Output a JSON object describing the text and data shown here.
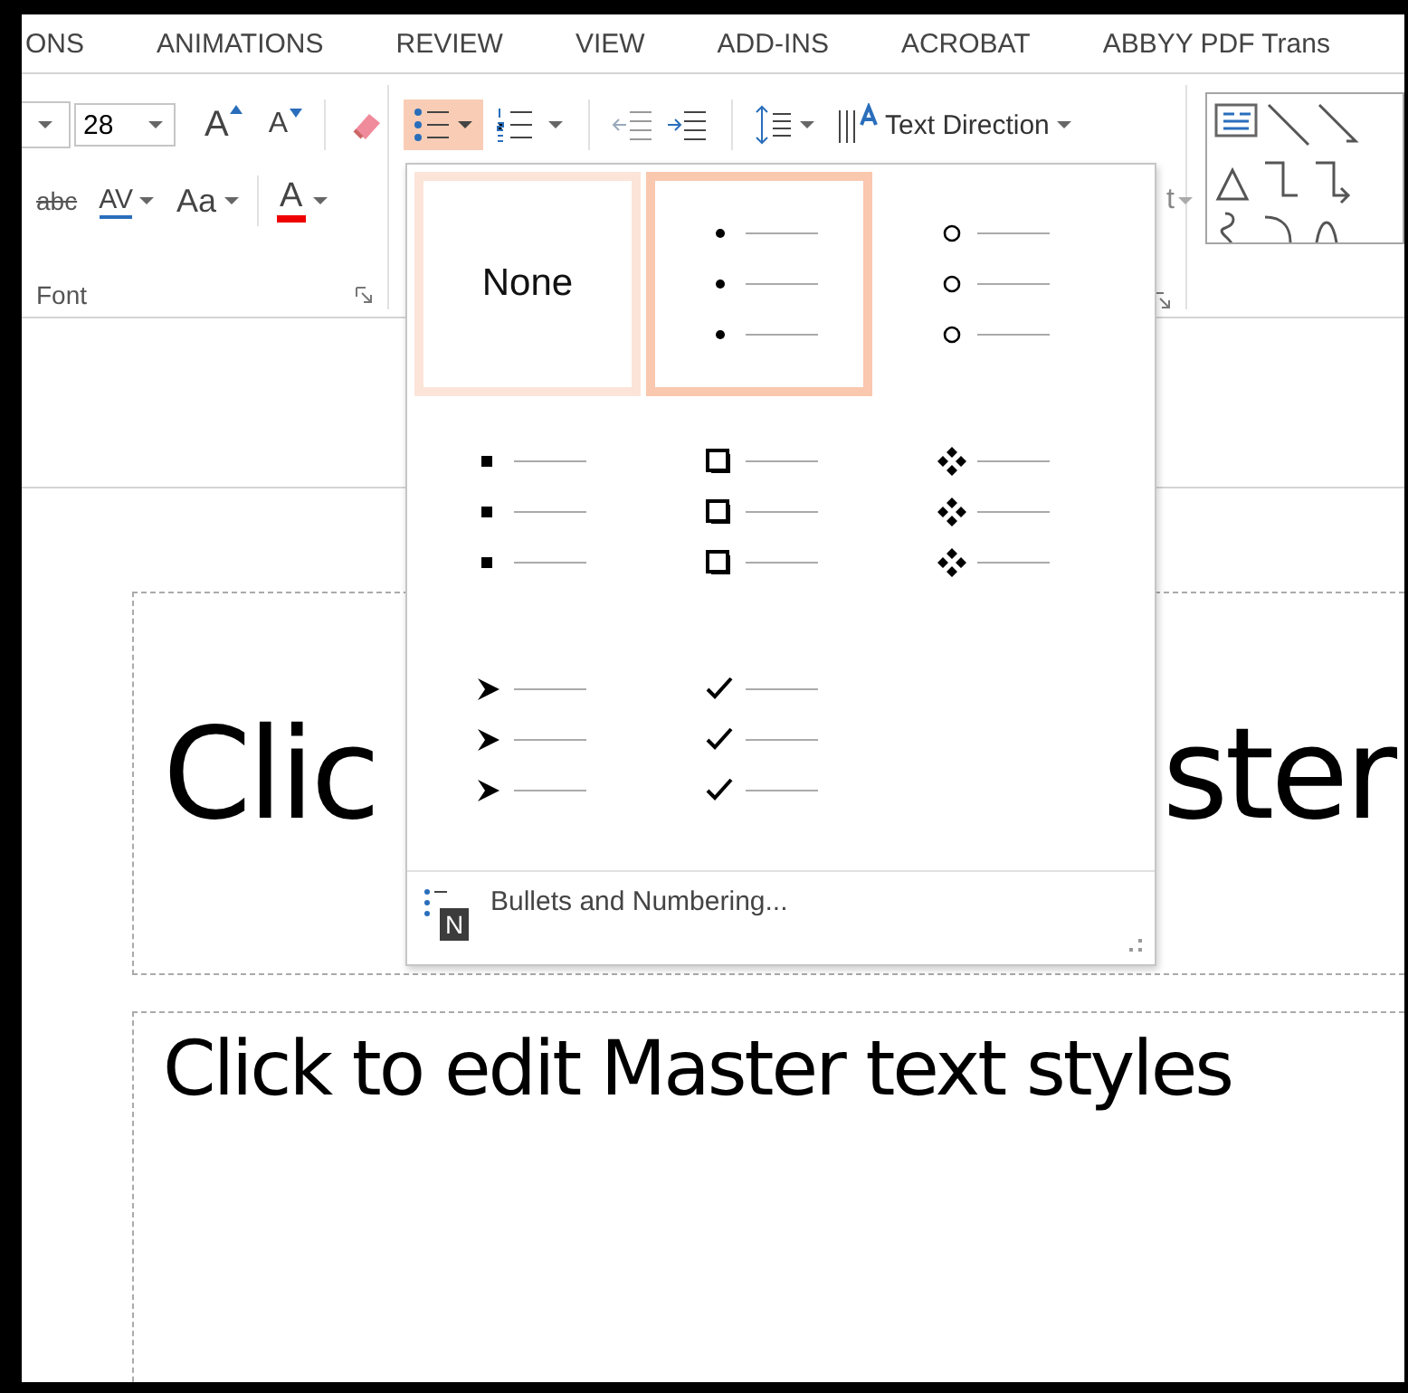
{
  "tabs": [
    {
      "label": "ONS"
    },
    {
      "label": "ANIMATIONS"
    },
    {
      "label": "REVIEW"
    },
    {
      "label": "VIEW"
    },
    {
      "label": "ADD-INS"
    },
    {
      "label": "ACROBAT"
    },
    {
      "label": "ABBYY PDF Trans"
    }
  ],
  "font_group": {
    "font_size": "28",
    "grow_glyph": "A",
    "shrink_glyph": "A",
    "strike_glyph": "abc",
    "spacing_glyph": "AV",
    "case_glyph": "Aa",
    "color_glyph": "A",
    "label": "Font"
  },
  "paragraph_group": {
    "bullets_pressed": true,
    "text_direction": "Text Direction",
    "fragment": "t"
  },
  "slide": {
    "title_left": "Clic",
    "title_right": "ster",
    "body": "Click to edit Master text styles"
  },
  "bullet_menu": {
    "options": [
      {
        "kind": "none",
        "label": "None",
        "selected": false,
        "highlighted": true
      },
      {
        "kind": "dot",
        "selected": true,
        "highlighted": false
      },
      {
        "kind": "circle",
        "selected": false,
        "highlighted": false
      },
      {
        "kind": "square",
        "selected": false,
        "highlighted": false
      },
      {
        "kind": "hollow-square",
        "selected": false,
        "highlighted": false
      },
      {
        "kind": "diamond",
        "selected": false,
        "highlighted": false
      },
      {
        "kind": "arrow",
        "selected": false,
        "highlighted": false
      },
      {
        "kind": "check",
        "selected": false,
        "highlighted": false
      }
    ],
    "footer": {
      "label": "Bullets and Numbering...",
      "keytip": "N"
    }
  }
}
